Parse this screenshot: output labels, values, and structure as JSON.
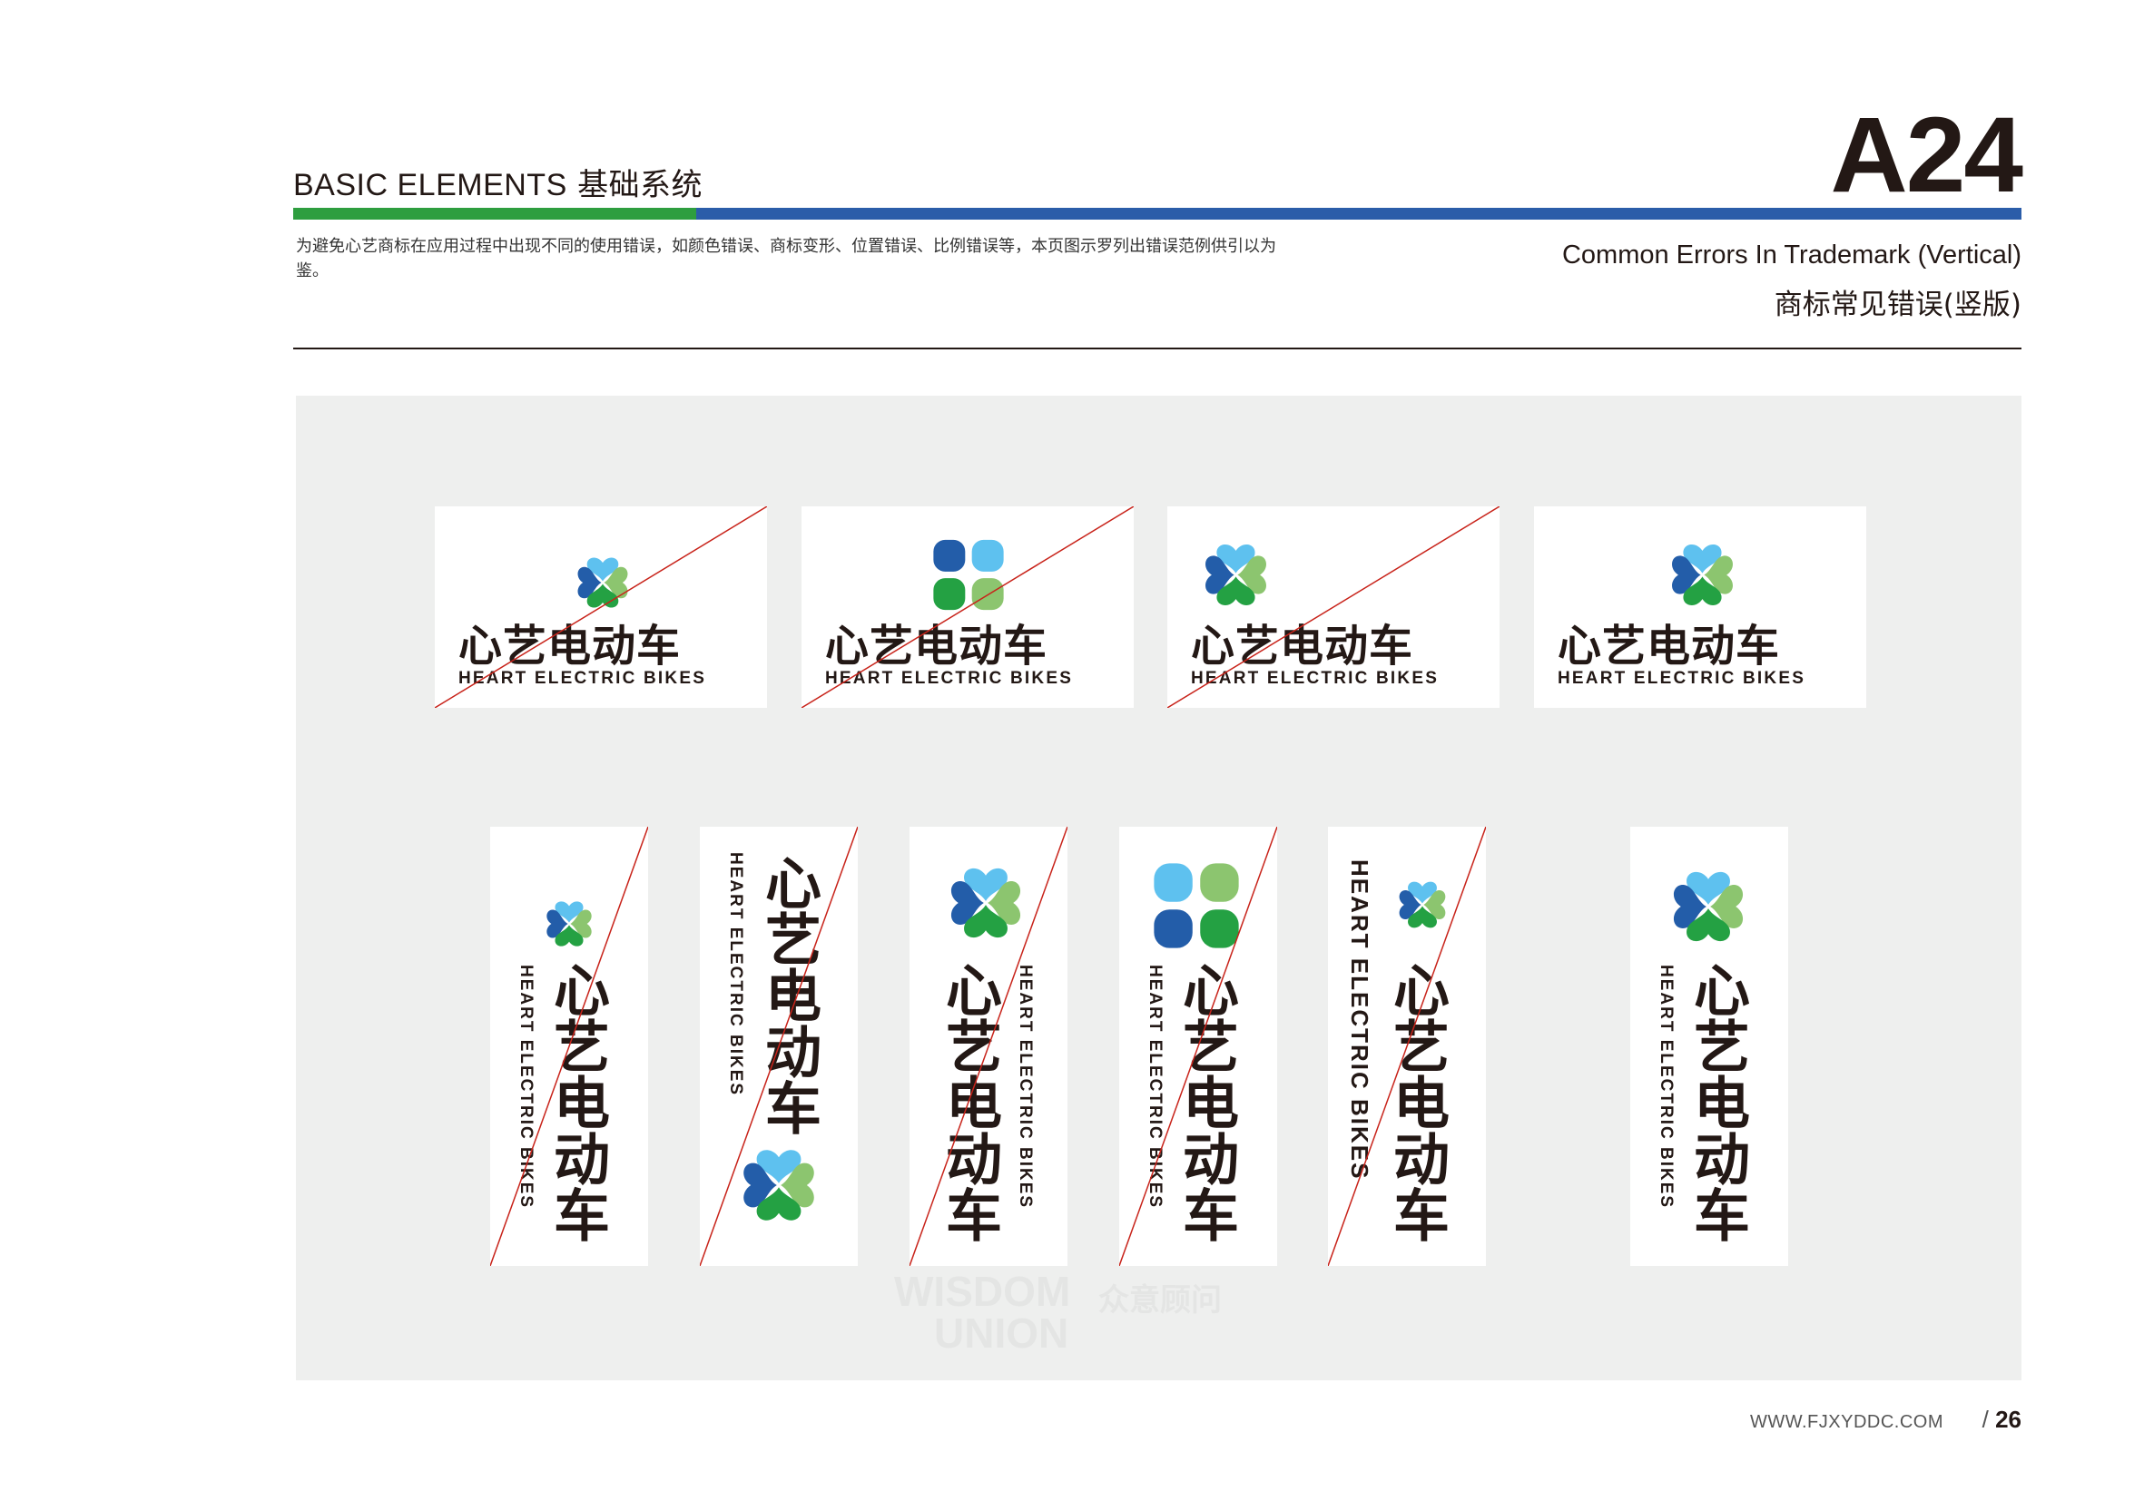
{
  "header": {
    "title_en": "BASIC ELEMENTS",
    "title_zh": "基础系统",
    "page_code": "A24"
  },
  "intro": {
    "description": "为避免心艺商标在应用过程中出现不同的使用错误，如颜色错误、商标变形、位置错误、比例错误等，本页图示罗列出错误范例供引以为鉴。"
  },
  "section": {
    "title_en": "Common Errors In Trademark (Vertical)",
    "title_zh": "商标常见错误(竖版)"
  },
  "logo": {
    "name_zh": "心艺电动车",
    "name_en": "HEART ELECTRIC BIKES"
  },
  "colors": {
    "green": "#2e9e3f",
    "blue": "#2b5da9",
    "petal_light_blue": "#5ec1ef",
    "petal_dark_blue": "#235da9",
    "petal_light_green": "#8cc56f",
    "petal_green": "#24a143",
    "error_line": "#c8231a",
    "panel": "#eeefee"
  },
  "icons": {
    "clover": "four-heart-clover-icon"
  },
  "watermark": {
    "line1": "WISDOM",
    "line2": "UNION",
    "zh": "众意顾问"
  },
  "footer": {
    "url": "WWW.FJXYDDC.COM",
    "page_number": "26"
  }
}
